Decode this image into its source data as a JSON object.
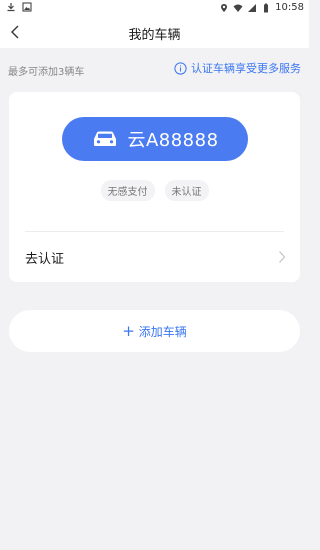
{
  "status_bar": {
    "time": "10:58",
    "left_icons": [
      "download-icon",
      "image-icon"
    ],
    "right_icons": [
      "location-icon",
      "wifi-icon",
      "signal-icon",
      "battery-icon"
    ]
  },
  "nav": {
    "title": "我的车辆",
    "back_icon": "chevron-left-icon"
  },
  "hint": {
    "limit_text": "最多可添加3辆车",
    "verify_promo": "认证车辆享受更多服务",
    "info_icon": "info-icon"
  },
  "vehicle": {
    "car_icon": "car-icon",
    "plate": "云A88888",
    "tags": [
      "无感支付",
      "未认证"
    ],
    "verify_action": "去认证",
    "chevron_icon": "chevron-right-icon"
  },
  "add_vehicle": {
    "plus": "+",
    "label": "添加车辆"
  },
  "colors": {
    "accent": "#3a76f2",
    "plate_bg": "#4b7bf0",
    "page_bg": "#f2f2f4"
  }
}
